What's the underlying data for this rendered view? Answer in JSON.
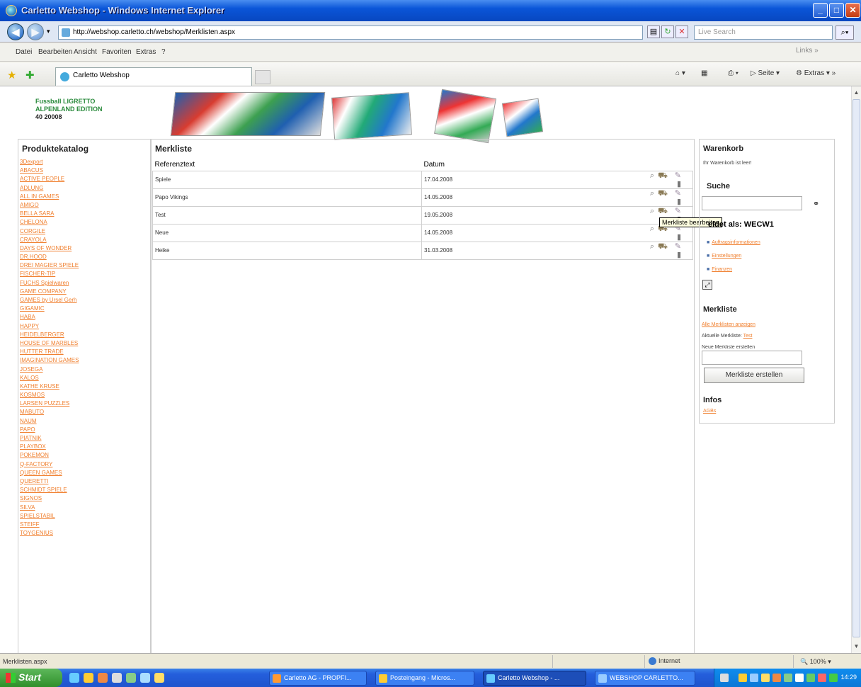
{
  "window": {
    "title": "Carletto Webshop - Windows Internet Explorer",
    "url": "http://webshop.carletto.ch/webshop/Merklisten.aspx",
    "search_placeholder": "Live Search"
  },
  "menu": [
    "Datei",
    "Bearbeiten",
    "Ansicht",
    "Favoriten",
    "Extras",
    "?"
  ],
  "menu_links": "Links",
  "tab": {
    "label": "Carletto Webshop"
  },
  "command_bar": {
    "page": "Seite",
    "tools": "Extras"
  },
  "header": {
    "logo_lines": [
      "Fussball LIGRETTO",
      "ALPENLAND EDITION",
      "40 20008"
    ]
  },
  "catalog": {
    "title": "Produktekatalog",
    "items": [
      "3Dexport",
      "ABACUS",
      "ACTIVE PEOPLE",
      "ADLUNG",
      "ALL IN GAMES",
      "AMIGO",
      "BELLA SARA",
      "CHELONA",
      "CORGILE",
      "CRAYOLA",
      "DAYS OF WONDER",
      "DR.HOOD",
      "DREI MAGIER SPIELE",
      "FISCHER-TIP",
      "FUCHS Spielwaren",
      "GAME COMPANY",
      "GAMES by Ursel Gerh",
      "GIGAMIC",
      "HABA",
      "HAPPY",
      "HEIDELBERGER",
      "HOUSE OF MARBLES",
      "HUTTER TRADE",
      "IMAGINATION GAMES",
      "JOSEGA",
      "KALOS",
      "KATHE KRUSE",
      "KOSMOS",
      "LARSEN PUZZLES",
      "MABUTO",
      "NAUM",
      "PAPO",
      "PIATNIK",
      "PLAYBOX",
      "POKEMON",
      "Q-FACTORY",
      "QUEEN GAMES",
      "QUERETTI",
      "SCHMIDT SPIELE",
      "SIGNOS",
      "SILVA",
      "SPIELSTABIL",
      "STEIFF",
      "TOYGENIUS"
    ]
  },
  "wishlist": {
    "title": "Merkliste",
    "col_ref": "Referenztext",
    "col_date": "Datum",
    "rows": [
      {
        "ref": "Spiele",
        "date": "17.04.2008"
      },
      {
        "ref": "Papo Vikings",
        "date": "14.05.2008"
      },
      {
        "ref": "Test",
        "date": "19.05.2008"
      },
      {
        "ref": "Neue",
        "date": "14.05.2008"
      },
      {
        "ref": "Heike",
        "date": "31.03.2008"
      }
    ],
    "tooltip": "Merkliste bearbeiten"
  },
  "sidebar": {
    "cart_title": "Warenkorb",
    "cart_empty": "Ihr Warenkorb ist leer!",
    "search_title": "Suche",
    "login_title": "eldet als: WECW1",
    "account_links": [
      "Auftragsinformationen",
      "Einstellungen",
      "Finanzen"
    ],
    "wishlist_title": "Merkliste",
    "wishlist_show_all": "Alle Merklisten anzeigen",
    "wishlist_current_label": "Aktuelle Merkliste:",
    "wishlist_current_value": "Test",
    "wishlist_new_label": "Neue Merkliste erstellen",
    "wishlist_create_button": "Merkliste erstellen",
    "infos_title": "Infos",
    "infos_link": "AGBs"
  },
  "statusbar": {
    "left": "Merklisten.aspx",
    "zone": "Internet",
    "zoom": "100%"
  },
  "taskbar": {
    "start": "Start",
    "tasks": [
      "Carletto AG - PROPFI...",
      "Posteingang - Micros...",
      "Carletto Webshop - ...",
      "WEBSHOP CARLETTO..."
    ],
    "clock": "14:29"
  }
}
